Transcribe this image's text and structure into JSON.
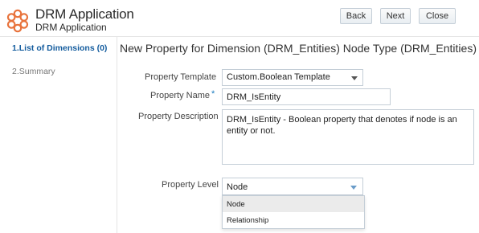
{
  "header": {
    "app_title": "DRM Application",
    "app_subtitle": "DRM Application",
    "buttons": {
      "back": "Back",
      "next": "Next",
      "close": "Close"
    },
    "logo_icon": "oracle-flower-icon",
    "logo_color": "#e8733c"
  },
  "nav": {
    "items": [
      {
        "label": "1.List of Dimensions (0)",
        "active": true
      },
      {
        "label": "2.Summary",
        "active": false
      }
    ],
    "active_color": "#145c9e"
  },
  "main": {
    "title": "New Property for Dimension (DRM_Entities) Node Type (DRM_Entities)",
    "form": {
      "template_label": "Property Template",
      "template_value": "Custom.Boolean Template",
      "name_label": "Property Name",
      "required_marker": "*",
      "name_value": "DRM_IsEntity",
      "description_label": "Property Description",
      "description_value": "DRM_IsEntity - Boolean property that denotes if node is an entity or not.",
      "level_label": "Property Level",
      "level_value": "Node",
      "level_options": [
        "Node",
        "Relationship"
      ]
    }
  }
}
